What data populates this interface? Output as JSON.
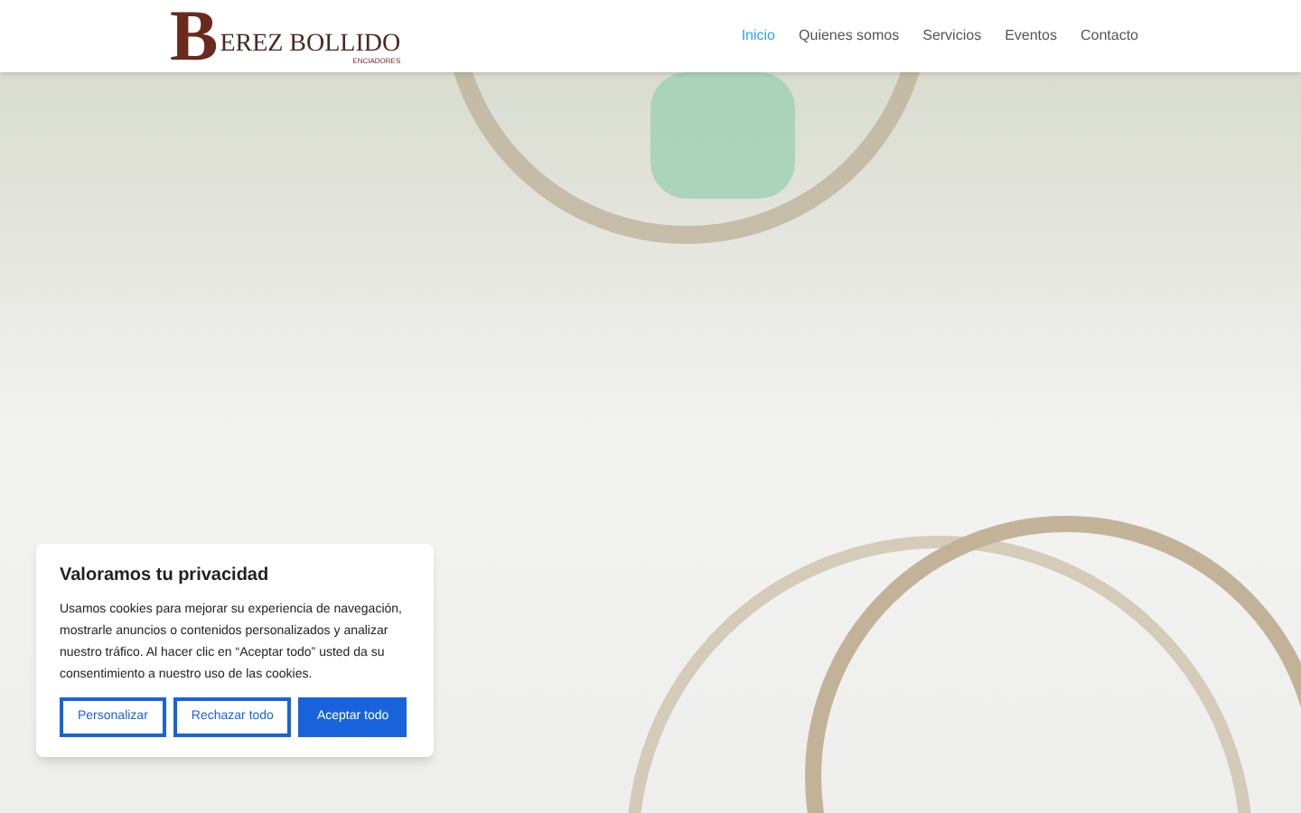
{
  "header": {
    "logo": {
      "initial": "B",
      "name": "EREZ BOLLIDO",
      "tagline": "ENCIADORES"
    },
    "nav": [
      {
        "label": "Inicio",
        "selected": true
      },
      {
        "label": "Quienes somos",
        "selected": false
      },
      {
        "label": "Servicios",
        "selected": false
      },
      {
        "label": "Eventos",
        "selected": false
      },
      {
        "label": "Contacto",
        "selected": false
      }
    ]
  },
  "cookie_banner": {
    "title": "Valoramos tu privacidad",
    "text": "Usamos cookies para mejorar su experiencia de navegación, mostrarle anuncios o contenidos personalizados y analizar nuestro tráfico. Al hacer clic en “Aceptar todo” usted da su consentimiento a nuestro uso de las cookies.",
    "buttons": [
      {
        "label": "Personalizar",
        "kind": "outline"
      },
      {
        "label": "Rechazar todo",
        "kind": "outline"
      },
      {
        "label": "Aceptar todo",
        "kind": "primary"
      }
    ]
  }
}
